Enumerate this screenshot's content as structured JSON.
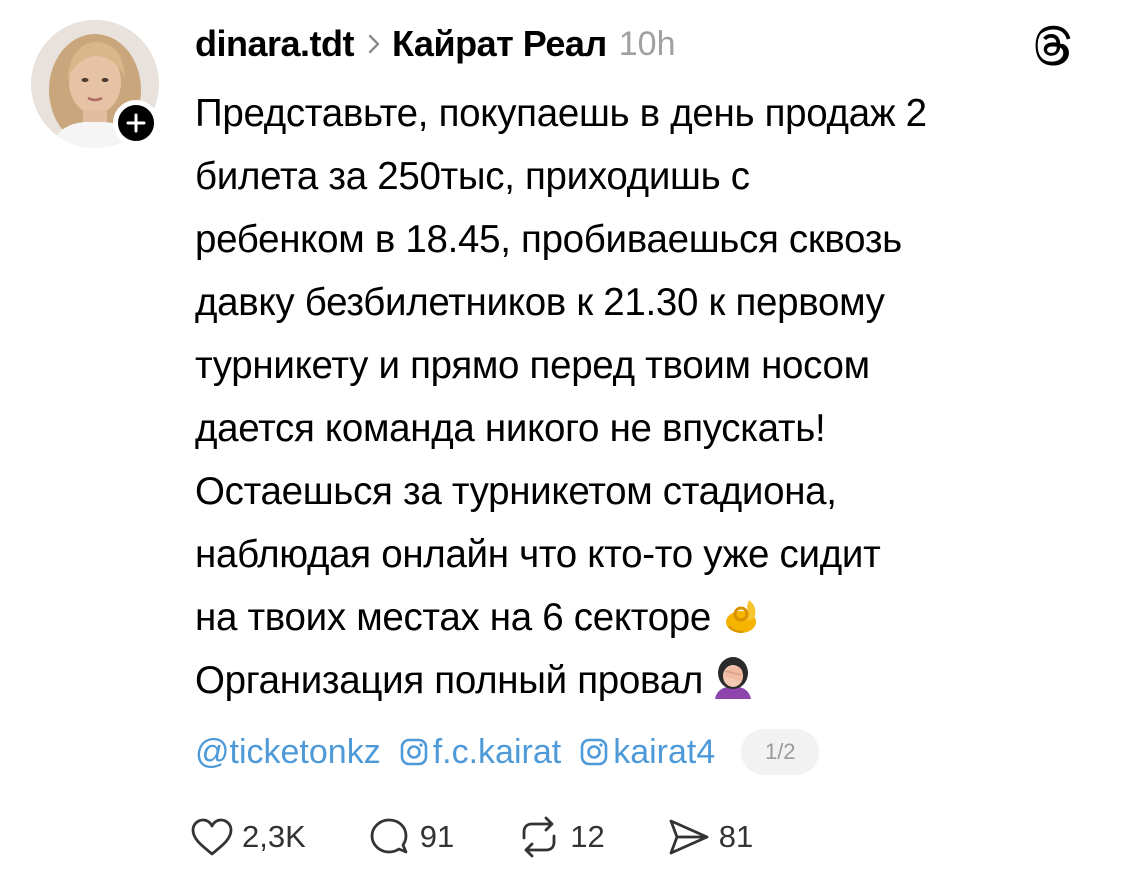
{
  "post": {
    "username": "dinara.tdt",
    "community": "Кайрат Реал",
    "time": "10h",
    "lines": [
      "Представьте, покупаешь в день продаж 2",
      "билета за 250тыс, приходишь с",
      "ребенком в 18.45, пробиваешься сквозь",
      "давку безбилетников к 21.30 к первому",
      "турникету и прямо перед твоим носом",
      "дается команда никого не впускать!",
      "Остаешься за турникетом стадиона,",
      "наблюдая онлайн что кто-то уже сидит",
      "на твоих местах на 6 секторе",
      "Организация полный провал"
    ],
    "emojis": [
      "pinched-fingers-icon",
      "facepalm-woman-icon"
    ],
    "mentions": {
      "ticketon": "@ticketonkz",
      "fckairat": "f.c.kairat",
      "kairat4": "kairat4"
    },
    "page_indicator": "1/2",
    "stats": {
      "likes": "2,3K",
      "replies": "91",
      "reposts": "12",
      "shares": "81"
    }
  },
  "colors": {
    "link": "#4e9ad9",
    "muted": "#a0a0a0",
    "text": "#000000"
  }
}
